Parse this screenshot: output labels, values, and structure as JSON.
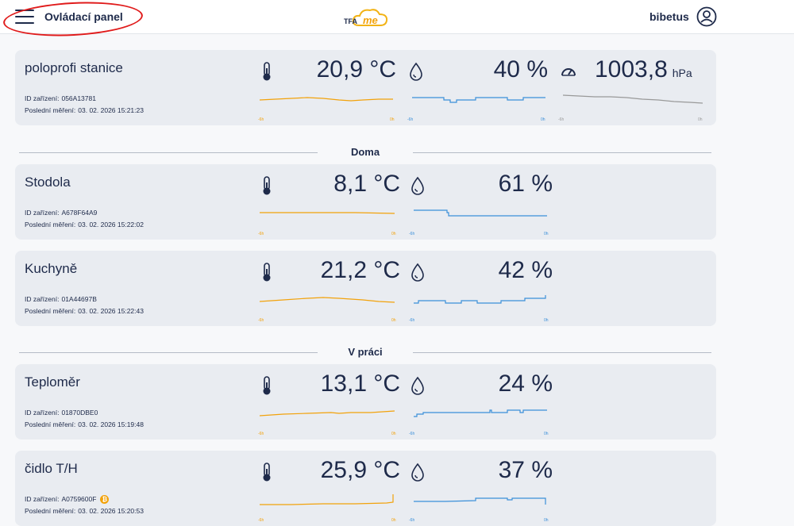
{
  "header": {
    "menu_label": "Ovládací panel",
    "logo_text": "TFA",
    "logo_text2": "me",
    "user_name": "bibetus"
  },
  "colors": {
    "temperature": "#f2a20b",
    "humidity": "#3a8fd9",
    "pressure": "#999999",
    "text": "#1e2a4a"
  },
  "labels": {
    "device_id": "ID zařízení:",
    "last_measurement": "Poslední měření:",
    "axis_start": "-6h",
    "axis_end": "0h"
  },
  "groups": [
    "Doma",
    "V práci"
  ],
  "stations": [
    {
      "name": "poloprofi stanice",
      "device_id": "056A13781",
      "last_measurement": "03. 02. 2026 15:21:23",
      "temperature": "20,9 °C",
      "humidity": "40 %",
      "pressure": "1003,8",
      "pressure_unit": "hPa"
    },
    {
      "name": "Stodola",
      "device_id": "A678F64A9",
      "last_measurement": "03. 02. 2026 15:22:02",
      "temperature": "8,1 °C",
      "humidity": "61 %"
    },
    {
      "name": "Kuchyně",
      "device_id": "01A44697B",
      "last_measurement": "03. 02. 2026 15:22:43",
      "temperature": "21,2 °C",
      "humidity": "42 %"
    },
    {
      "name": "Teploměr",
      "device_id": "01870DBE0",
      "last_measurement": "03. 02. 2026 15:19:48",
      "temperature": "13,1 °C",
      "humidity": "24 %"
    },
    {
      "name": "čidlo T/H",
      "device_id": "A0759600F",
      "last_measurement": "03. 02. 2026 15:20:53",
      "temperature": "25,9 °C",
      "humidity": "37 %",
      "badge": "₿"
    }
  ]
}
